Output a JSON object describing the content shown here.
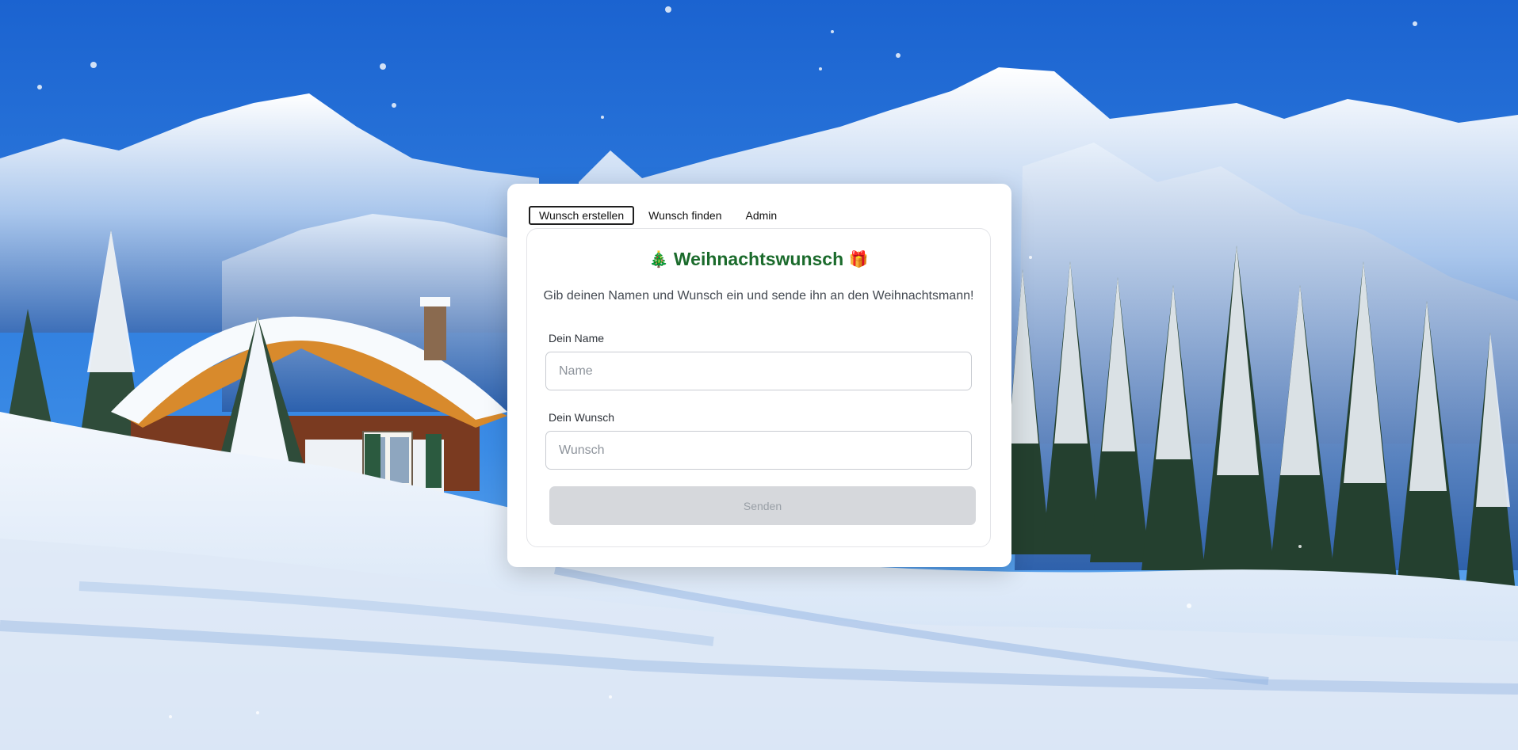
{
  "tabs": [
    {
      "label": "Wunsch erstellen",
      "active": true
    },
    {
      "label": "Wunsch finden",
      "active": false
    },
    {
      "label": "Admin",
      "active": false
    }
  ],
  "form": {
    "title_emoji_left": "🎄",
    "title": "Weihnachtswunsch",
    "title_emoji_right": "🎁",
    "subtitle": "Gib deinen Namen und Wunsch ein und sende ihn an den Weihnachtsmann!",
    "name_label": "Dein Name",
    "name_placeholder": "Name",
    "name_value": "",
    "wish_label": "Dein Wunsch",
    "wish_placeholder": "Wunsch",
    "wish_value": "",
    "submit_label": "Senden",
    "submit_disabled": true
  },
  "colors": {
    "title_green": "#1b6b2c",
    "sky_blue": "#1f6fd6",
    "button_disabled": "#d6d8dc"
  },
  "background": {
    "scene": "snowy mountain landscape with snow-covered chalet and pine trees, falling snowflakes"
  }
}
